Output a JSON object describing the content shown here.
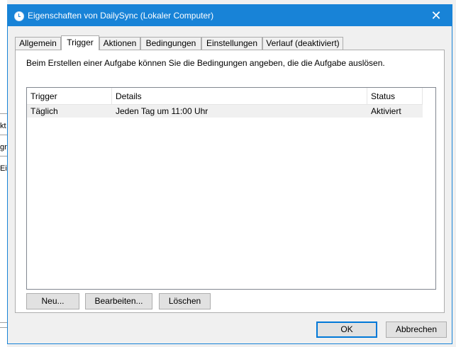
{
  "window": {
    "title": "Eigenschaften von DailySync (Lokaler Computer)",
    "close_glyph": "✕"
  },
  "background_fragments": [
    "kt",
    "gr",
    "Ei"
  ],
  "tabs": [
    {
      "label": "Allgemein",
      "active": false
    },
    {
      "label": "Trigger",
      "active": true
    },
    {
      "label": "Aktionen",
      "active": false
    },
    {
      "label": "Bedingungen",
      "active": false
    },
    {
      "label": "Einstellungen",
      "active": false
    },
    {
      "label": "Verlauf (deaktiviert)",
      "active": false
    }
  ],
  "trigger_panel": {
    "description": "Beim Erstellen einer Aufgabe können Sie die Bedingungen angeben, die die Aufgabe auslösen.",
    "columns": [
      "Trigger",
      "Details",
      "Status"
    ],
    "rows": [
      {
        "trigger": "Täglich",
        "details": "Jeden Tag um 11:00 Uhr",
        "status": "Aktiviert"
      }
    ],
    "buttons": {
      "new": "Neu...",
      "edit": "Bearbeiten...",
      "delete": "Löschen"
    }
  },
  "footer": {
    "ok": "OK",
    "cancel": "Abbrechen"
  },
  "colors": {
    "titlebar": "#1883d7",
    "selection_row": "#f0f0f0",
    "default_button_border": "#0078d7"
  }
}
